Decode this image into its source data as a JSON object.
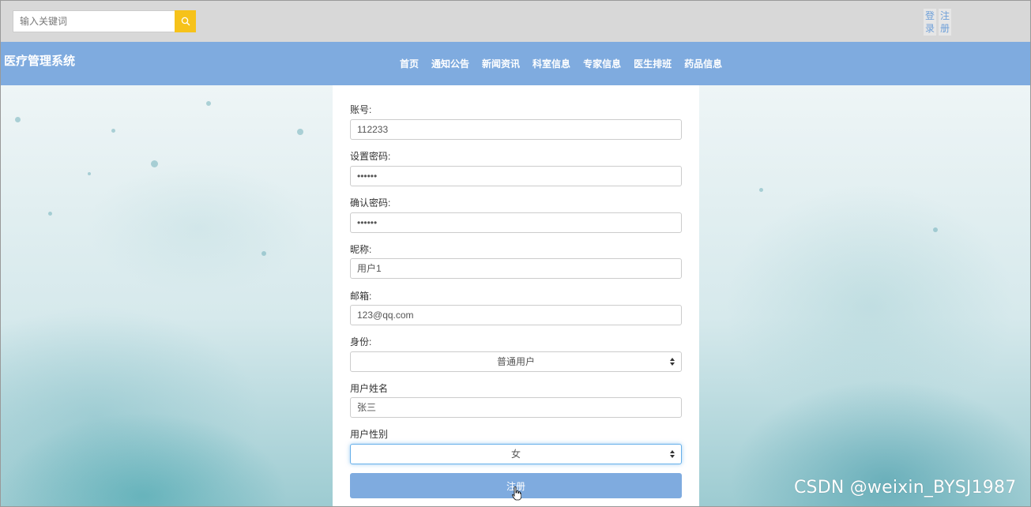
{
  "search": {
    "placeholder": "输入关键词",
    "icon": "search-icon"
  },
  "auth": {
    "login_label": "登录",
    "register_label": "注册"
  },
  "navbar": {
    "brand": "医疗管理系统",
    "items": [
      {
        "label": "首页"
      },
      {
        "label": "通知公告"
      },
      {
        "label": "新闻资讯"
      },
      {
        "label": "科室信息"
      },
      {
        "label": "专家信息"
      },
      {
        "label": "医生排班"
      },
      {
        "label": "药品信息"
      }
    ]
  },
  "form": {
    "account_label": "账号:",
    "account_value": "112233",
    "password_label": "设置密码:",
    "password_value": "••••••",
    "confirm_label": "确认密码:",
    "confirm_value": "••••••",
    "nickname_label": "昵称:",
    "nickname_value": "用户1",
    "email_label": "邮箱:",
    "email_value": "123@qq.com",
    "identity_label": "身份:",
    "identity_value": "普通用户",
    "realname_label": "用户姓名",
    "realname_value": "张三",
    "gender_label": "用户性别",
    "gender_value": "女",
    "submit_label": "注册"
  },
  "watermark": "CSDN @weixin_BYSJ1987",
  "colors": {
    "topbar": "#d8d8d8",
    "navbar": "#7fabdf",
    "search_button": "#f6c21a",
    "submit_button": "#7fabdf",
    "auth_link_text": "#6d9fd8"
  }
}
